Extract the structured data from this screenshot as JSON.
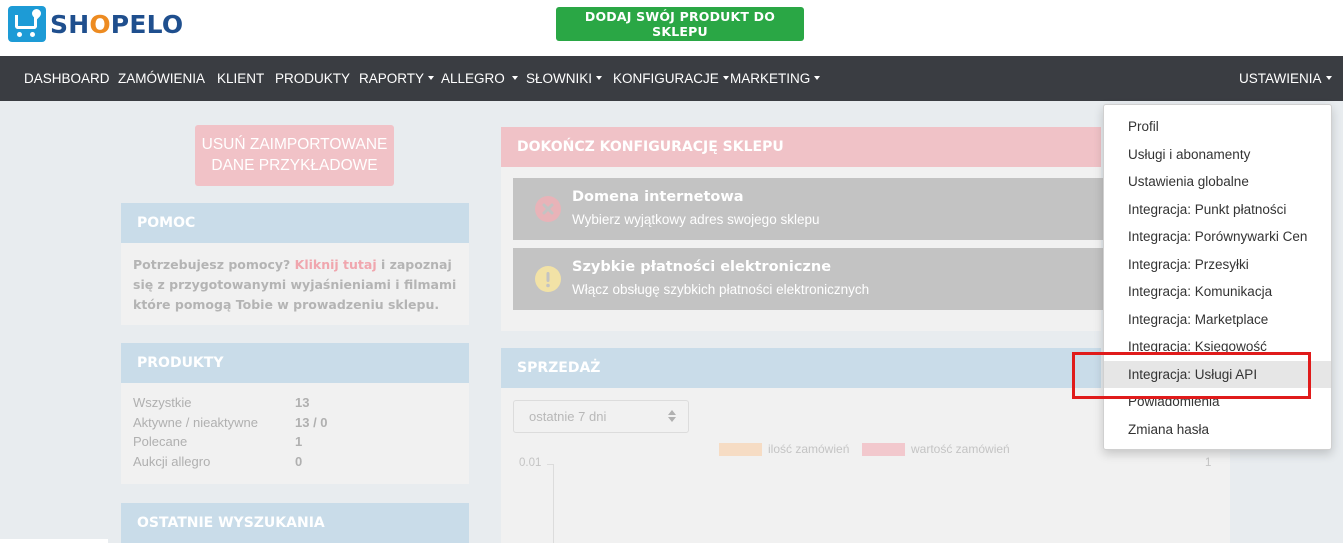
{
  "brand": {
    "name_start": "SH",
    "name_o": "O",
    "name_end": "PELO"
  },
  "header": {
    "add_product_label": "DODAJ SWÓJ PRODUKT DO SKLEPU"
  },
  "nav": {
    "items": [
      "DASHBOARD",
      "ZAMÓWIENIA",
      "KLIENT",
      "PRODUKTY",
      "RAPORTY",
      "ALLEGRO",
      "SŁOWNIKI",
      "KONFIGURACJE",
      "MARKETING"
    ],
    "settings": "USTAWIENIA"
  },
  "left": {
    "remove_button": "USUŃ ZAIMPORTOWANE DANE PRZYKŁADOWE",
    "help": {
      "title": "POMOC",
      "text_before": "Potrzebujesz pomocy? ",
      "link": "Kliknij tutaj",
      "text_after": " i zapoznaj się z przygotowanymi wyjaśnieniami i filmami które pomogą Tobie w prowadzeniu sklepu."
    },
    "products": {
      "title": "PRODUKTY",
      "rows": [
        {
          "label": "Wszystkie",
          "value": "13"
        },
        {
          "label": "Aktywne / nieaktywne",
          "value": "13 / 0"
        },
        {
          "label": "Polecane",
          "value": "1"
        },
        {
          "label": "Aukcji allegro",
          "value": "0"
        }
      ]
    },
    "searches": {
      "title": "OSTATNIE WYSZUKANIA"
    }
  },
  "config": {
    "title": "DOKOŃCZ KONFIGURACJĘ SKLEPU",
    "tasks": [
      {
        "title": "Domena internetowa",
        "subtitle": "Wybierz wyjątkowy adres swojego sklepu",
        "icon": "close-icon"
      },
      {
        "title": "Szybkie płatności elektroniczne",
        "subtitle": "Włącz obsługę szybkich płatności elektronicznych",
        "icon": "warning-icon"
      }
    ]
  },
  "sales": {
    "title": "SPRZEDAŻ",
    "period": "ostatnie 7 dni",
    "legend": [
      "ilość zamówień",
      "wartość zamówień"
    ],
    "y_left_top": "0.01",
    "y_right_top": "1"
  },
  "dropdown": {
    "items": [
      "Profil",
      "Usługi i abonamenty",
      "Ustawienia globalne",
      "Integracja: Punkt płatności",
      "Integracja: Porównywarki Cen",
      "Integracja: Przesyłki",
      "Integracja: Komunikacja",
      "Integracja: Marketplace",
      "Integracja: Księgowość",
      "Integracja: Usługi API",
      "Powiadomienia",
      "Zmiana hasła"
    ],
    "active_index": 9
  },
  "colors": {
    "nav_bg": "#3a3d42",
    "add_button": "#2aa745",
    "highlight": "#e01b1b",
    "legend_orders": "#f6dcc4",
    "legend_value": "#f2c8cd"
  }
}
